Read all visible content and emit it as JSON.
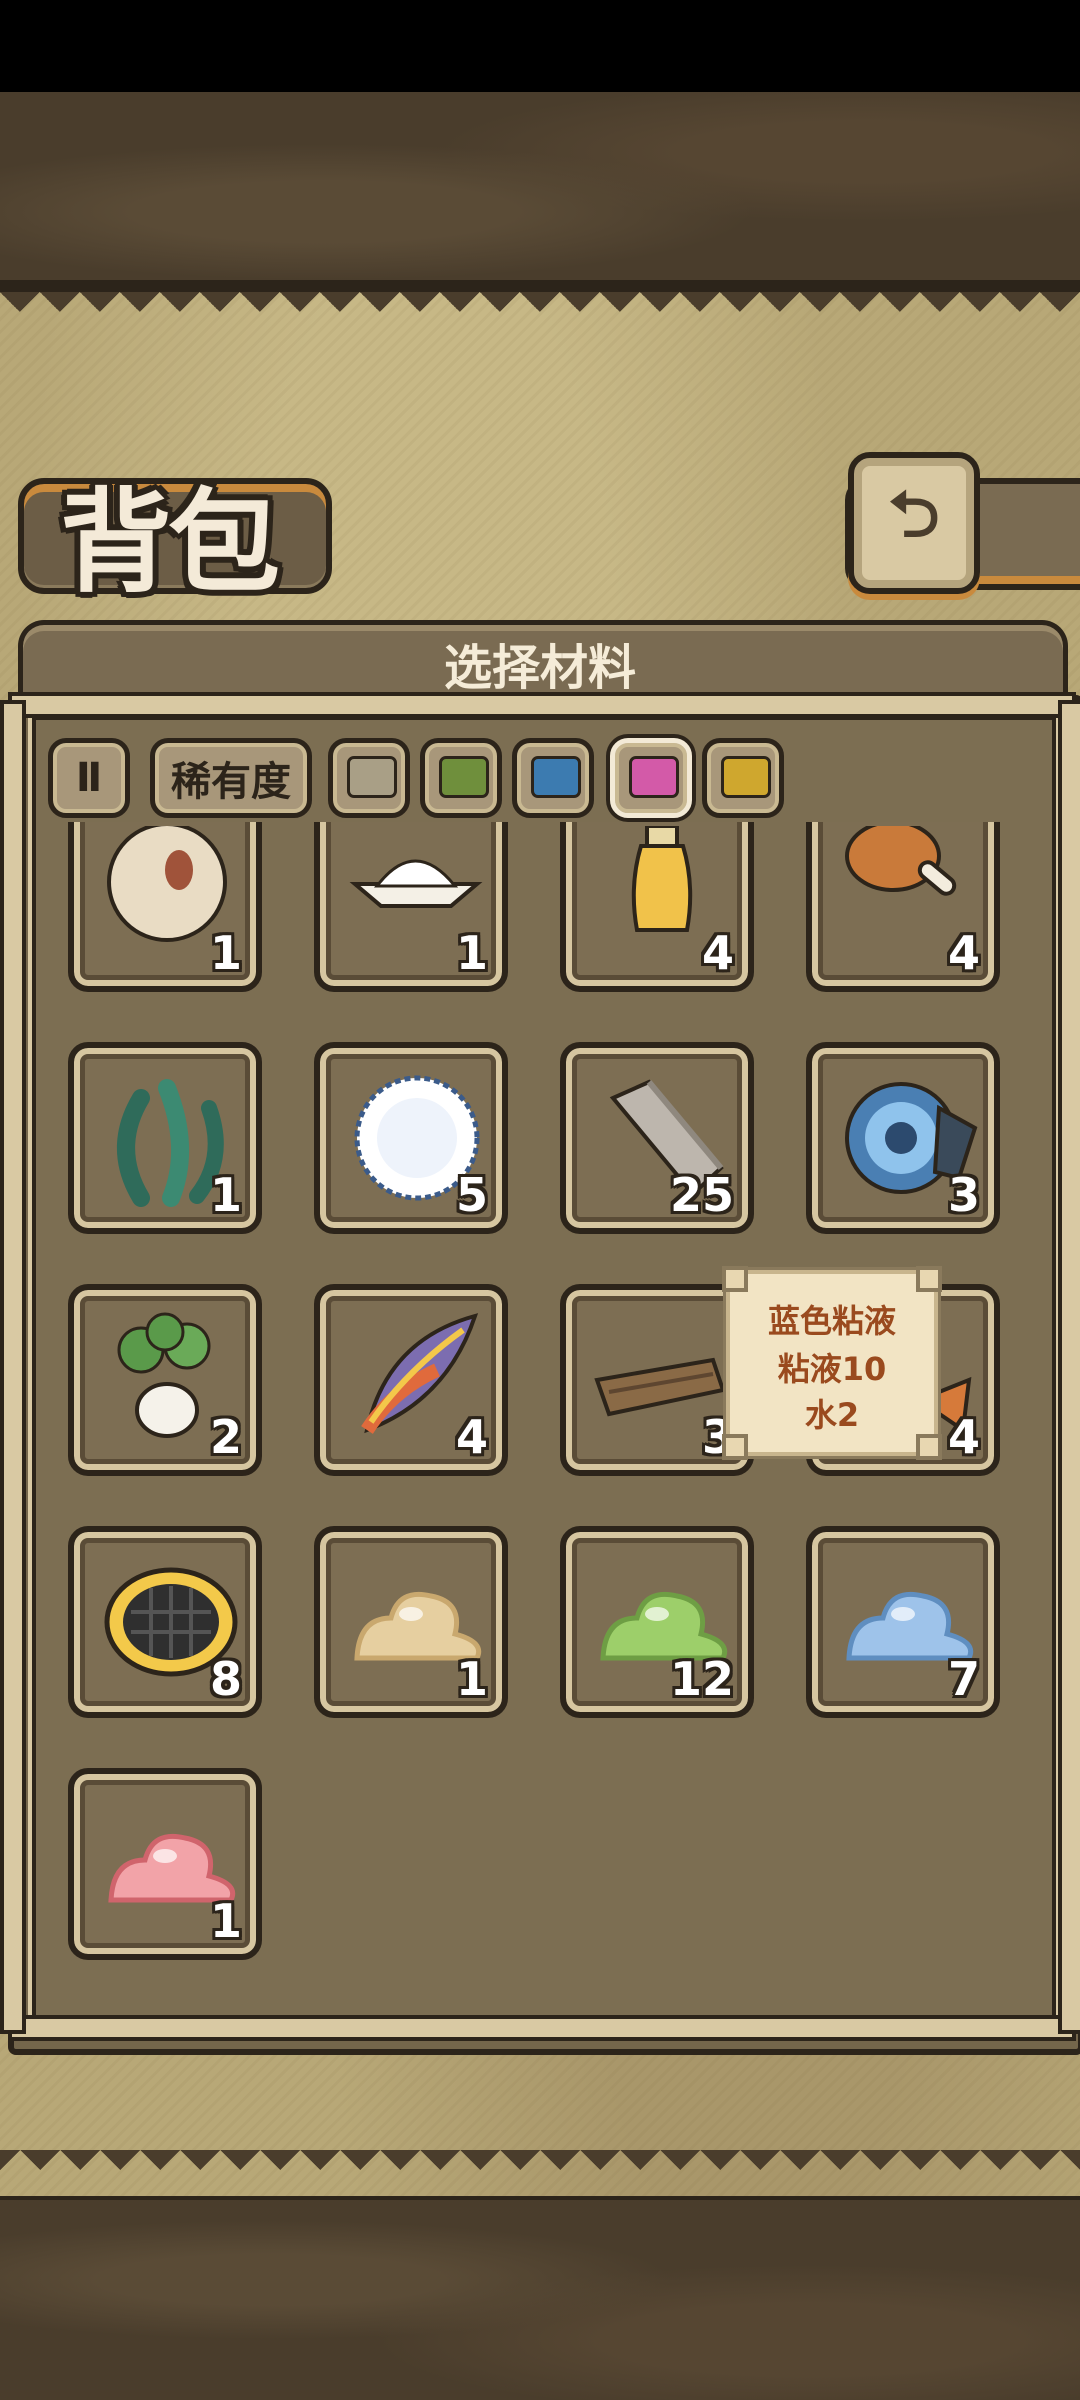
{
  "page": {
    "title": "背包",
    "panel_title": "选择材料",
    "back_label": "⮌"
  },
  "filters": {
    "pause_label": "Ⅱ",
    "rarity_label": "稀有度",
    "colors": [
      {
        "name": "gray",
        "color": "#a99f86"
      },
      {
        "name": "green",
        "color": "#6f8f3c"
      },
      {
        "name": "blue",
        "color": "#3c7bb0"
      },
      {
        "name": "pink",
        "color": "#d35aa8"
      },
      {
        "name": "yellow",
        "color": "#cfa72e"
      }
    ],
    "selected_color": "pink"
  },
  "items": [
    {
      "name": "spotted-egg",
      "icon": "egg-icon",
      "count": "1"
    },
    {
      "name": "salt-pile",
      "icon": "salt-icon",
      "count": "1"
    },
    {
      "name": "oil-bottle",
      "icon": "bottle-icon",
      "count": "4"
    },
    {
      "name": "chicken-drumstick",
      "icon": "drumstick-icon",
      "count": "4"
    },
    {
      "name": "seaweed",
      "icon": "seaweed-icon",
      "count": "1"
    },
    {
      "name": "white-fluff",
      "icon": "fluff-icon",
      "count": "5"
    },
    {
      "name": "stone-block",
      "icon": "stone-icon",
      "count": "25"
    },
    {
      "name": "blue-shell",
      "icon": "shell-icon",
      "count": "3"
    },
    {
      "name": "white-radish",
      "icon": "radish-icon",
      "count": "2"
    },
    {
      "name": "rainbow-feather",
      "icon": "feather-icon",
      "count": "4"
    },
    {
      "name": "wood-plank",
      "icon": "plank-icon",
      "count": "3"
    },
    {
      "name": "covered-item",
      "icon": "orange-item-icon",
      "count": "4"
    },
    {
      "name": "black-honeycomb",
      "icon": "honeycomb-icon",
      "count": "8"
    },
    {
      "name": "yellow-slime",
      "icon": "slime-icon",
      "count": "1"
    },
    {
      "name": "green-slime",
      "icon": "slime-icon",
      "count": "12"
    },
    {
      "name": "blue-slime",
      "icon": "slime-icon",
      "count": "7"
    },
    {
      "name": "pink-slime",
      "icon": "slime-icon",
      "count": "1"
    }
  ],
  "tooltip": {
    "title": "蓝色粘液",
    "line1": "粘液10",
    "line2": "水2"
  }
}
